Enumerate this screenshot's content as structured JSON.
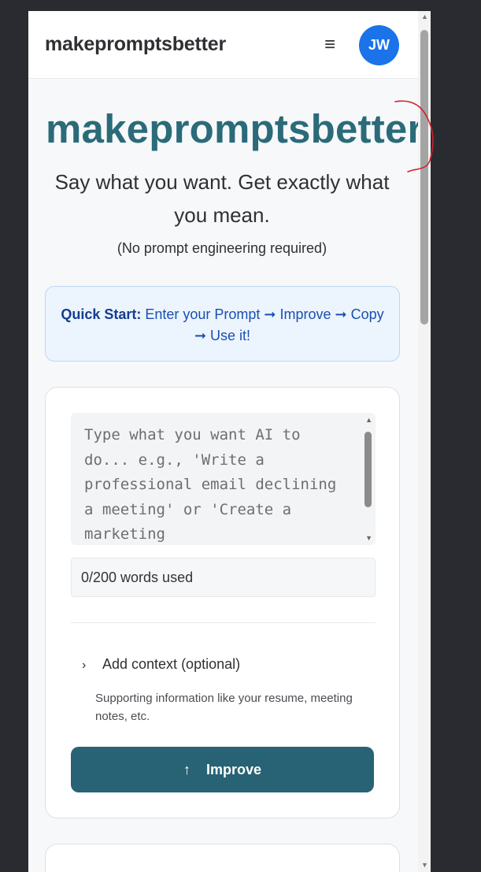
{
  "header": {
    "brand": "makepromptsbetter",
    "menu_icon": "≡",
    "avatar_initials": "JW"
  },
  "hero": {
    "title": "makepromptsbetter",
    "subtitle": "Say what you want. Get exactly what you mean.",
    "note": "(No prompt engineering required)"
  },
  "quick_start": {
    "label": "Quick Start:",
    "text": "Enter your Prompt ➞ Improve ➞ Copy ➞ Use it!"
  },
  "prompt": {
    "placeholder": "Type what you want AI to do... e.g., 'Write a professional email declining a meeting' or 'Create a marketing",
    "word_count": "0/200 words used"
  },
  "context": {
    "chevron": "›",
    "label": "Add context (optional)",
    "help": "Supporting information like your resume, meeting notes, etc."
  },
  "improve_button": {
    "icon": "↑",
    "label": "Improve"
  },
  "colors": {
    "brand_teal": "#2b6b79",
    "button_teal": "#276374",
    "avatar_blue": "#1a73e8",
    "quickstart_bg": "#ecf4fe",
    "annotation_red": "#d2212a"
  }
}
